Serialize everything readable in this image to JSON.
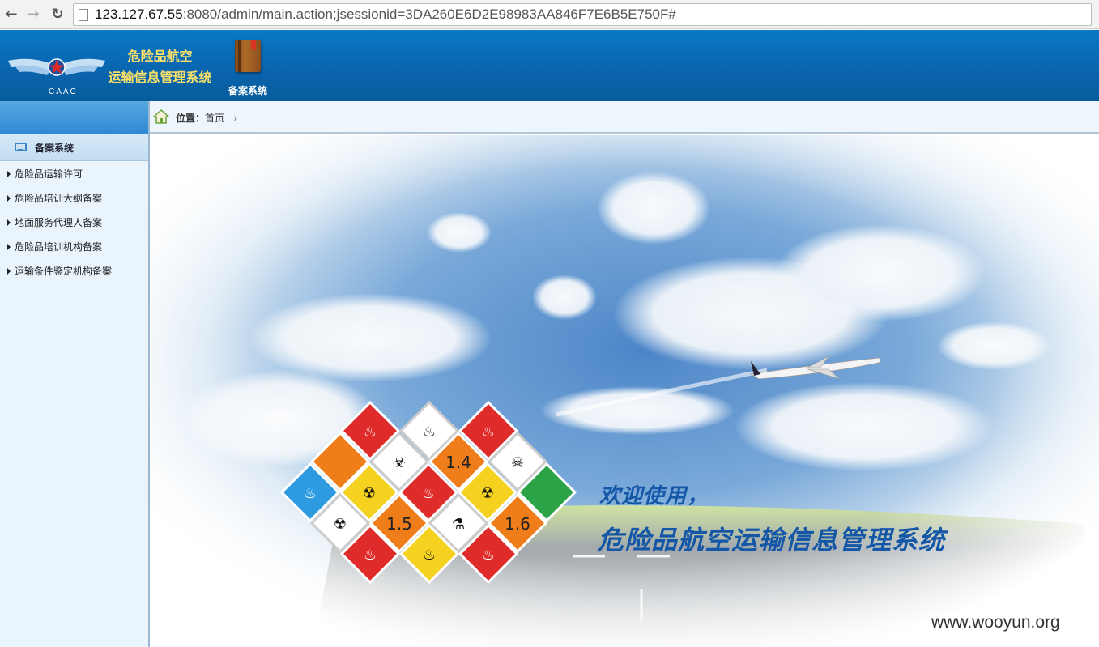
{
  "browser": {
    "url_host": "123.127.67.55",
    "url_rest": ":8080/admin/main.action;jsessionid=3DA260E6D2E98983AA846F7E6B5E750F#"
  },
  "header": {
    "logo_text": "CAAC",
    "title_line1": "危险品航空",
    "title_line2": "运输信息管理系统",
    "module_label": "备案系统"
  },
  "sidebar": {
    "section_label": "备案系统",
    "items": [
      {
        "label": "危险品运输许可"
      },
      {
        "label": "危险品培训大纲备案"
      },
      {
        "label": "地面服务代理人备案"
      },
      {
        "label": "危险品培训机构备案"
      },
      {
        "label": "运输条件鉴定机构备案"
      }
    ]
  },
  "breadcrumb": {
    "prefix": "位置：",
    "page": "首页",
    "separator": "›"
  },
  "hero": {
    "welcome": "欢迎使用，",
    "system_name": "危险品航空运输信息管理系统",
    "placard_labels": [
      "1.4",
      "1.5",
      "1.6"
    ]
  },
  "watermark": "www.wooyun.org",
  "colors": {
    "header_blue": "#0a6db5",
    "title_gold": "#f8e06a",
    "hero_text": "#1557a7"
  }
}
